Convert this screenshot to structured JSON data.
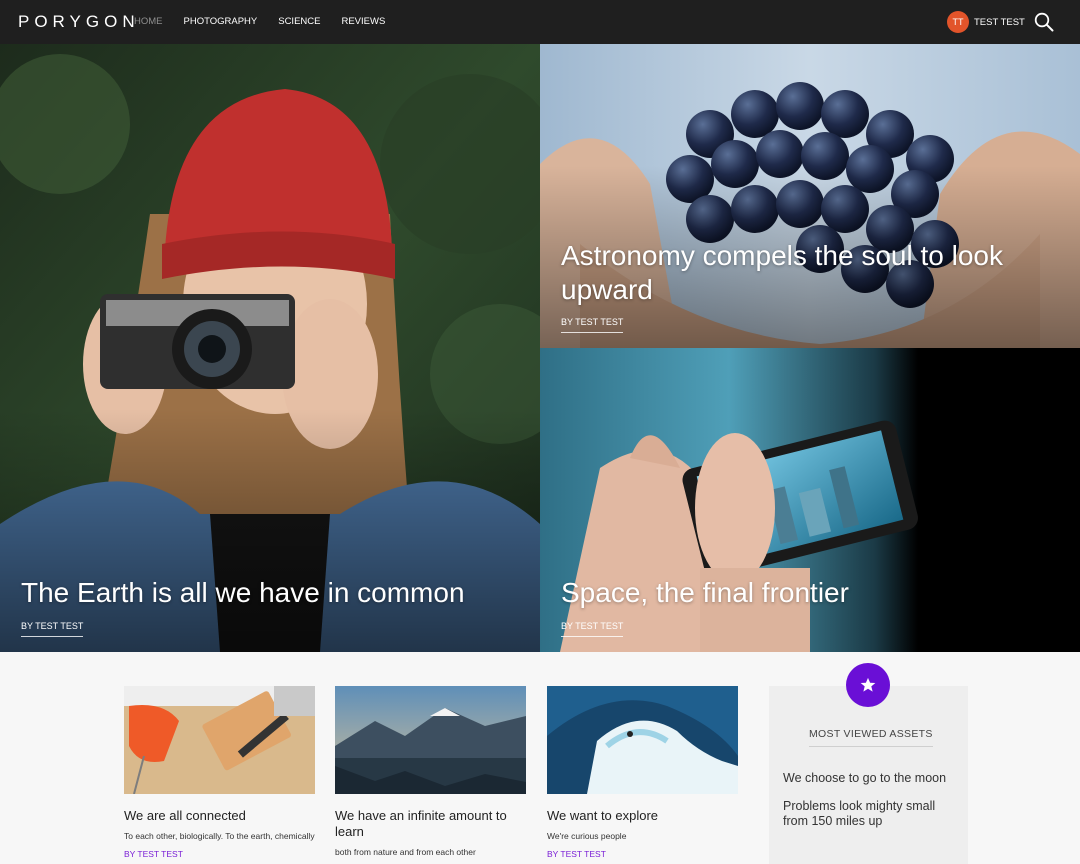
{
  "header": {
    "logo": "PORYGON",
    "nav": [
      {
        "label": "HOME",
        "active": true
      },
      {
        "label": "PHOTOGRAPHY",
        "active": false
      },
      {
        "label": "SCIENCE",
        "active": false
      },
      {
        "label": "REVIEWS",
        "active": false
      }
    ],
    "user_initials": "TT",
    "user_name": "TEST TEST",
    "search_icon": "search-icon"
  },
  "hero": {
    "main": {
      "title": "The Earth is all we have in common",
      "byline": "BY TEST TEST"
    },
    "top_right": {
      "title": "Astronomy compels the soul to look upward",
      "byline": "BY TEST TEST"
    },
    "bottom_right": {
      "title": "Space, the final frontier",
      "byline": "BY TEST TEST"
    }
  },
  "cards": [
    {
      "title": "We are all connected",
      "description": "To each other, biologically. To the earth, chemically",
      "byline": "BY TEST TEST"
    },
    {
      "title": "We have an infinite amount to learn",
      "description": "both from nature and from each other",
      "byline": ""
    },
    {
      "title": "We want to explore",
      "description": "We're curious people",
      "byline": "BY TEST TEST"
    }
  ],
  "sidebar": {
    "icon": "star-icon",
    "heading": "MOST VIEWED ASSETS",
    "items": [
      "We choose to go to the moon",
      "Problems look mighty small from 150 miles up"
    ]
  },
  "colors": {
    "header_bg": "#1f1f1f",
    "avatar": "#e2542a",
    "accent_purple": "#6a0fd6",
    "byline_purple": "#7a1fd6"
  }
}
